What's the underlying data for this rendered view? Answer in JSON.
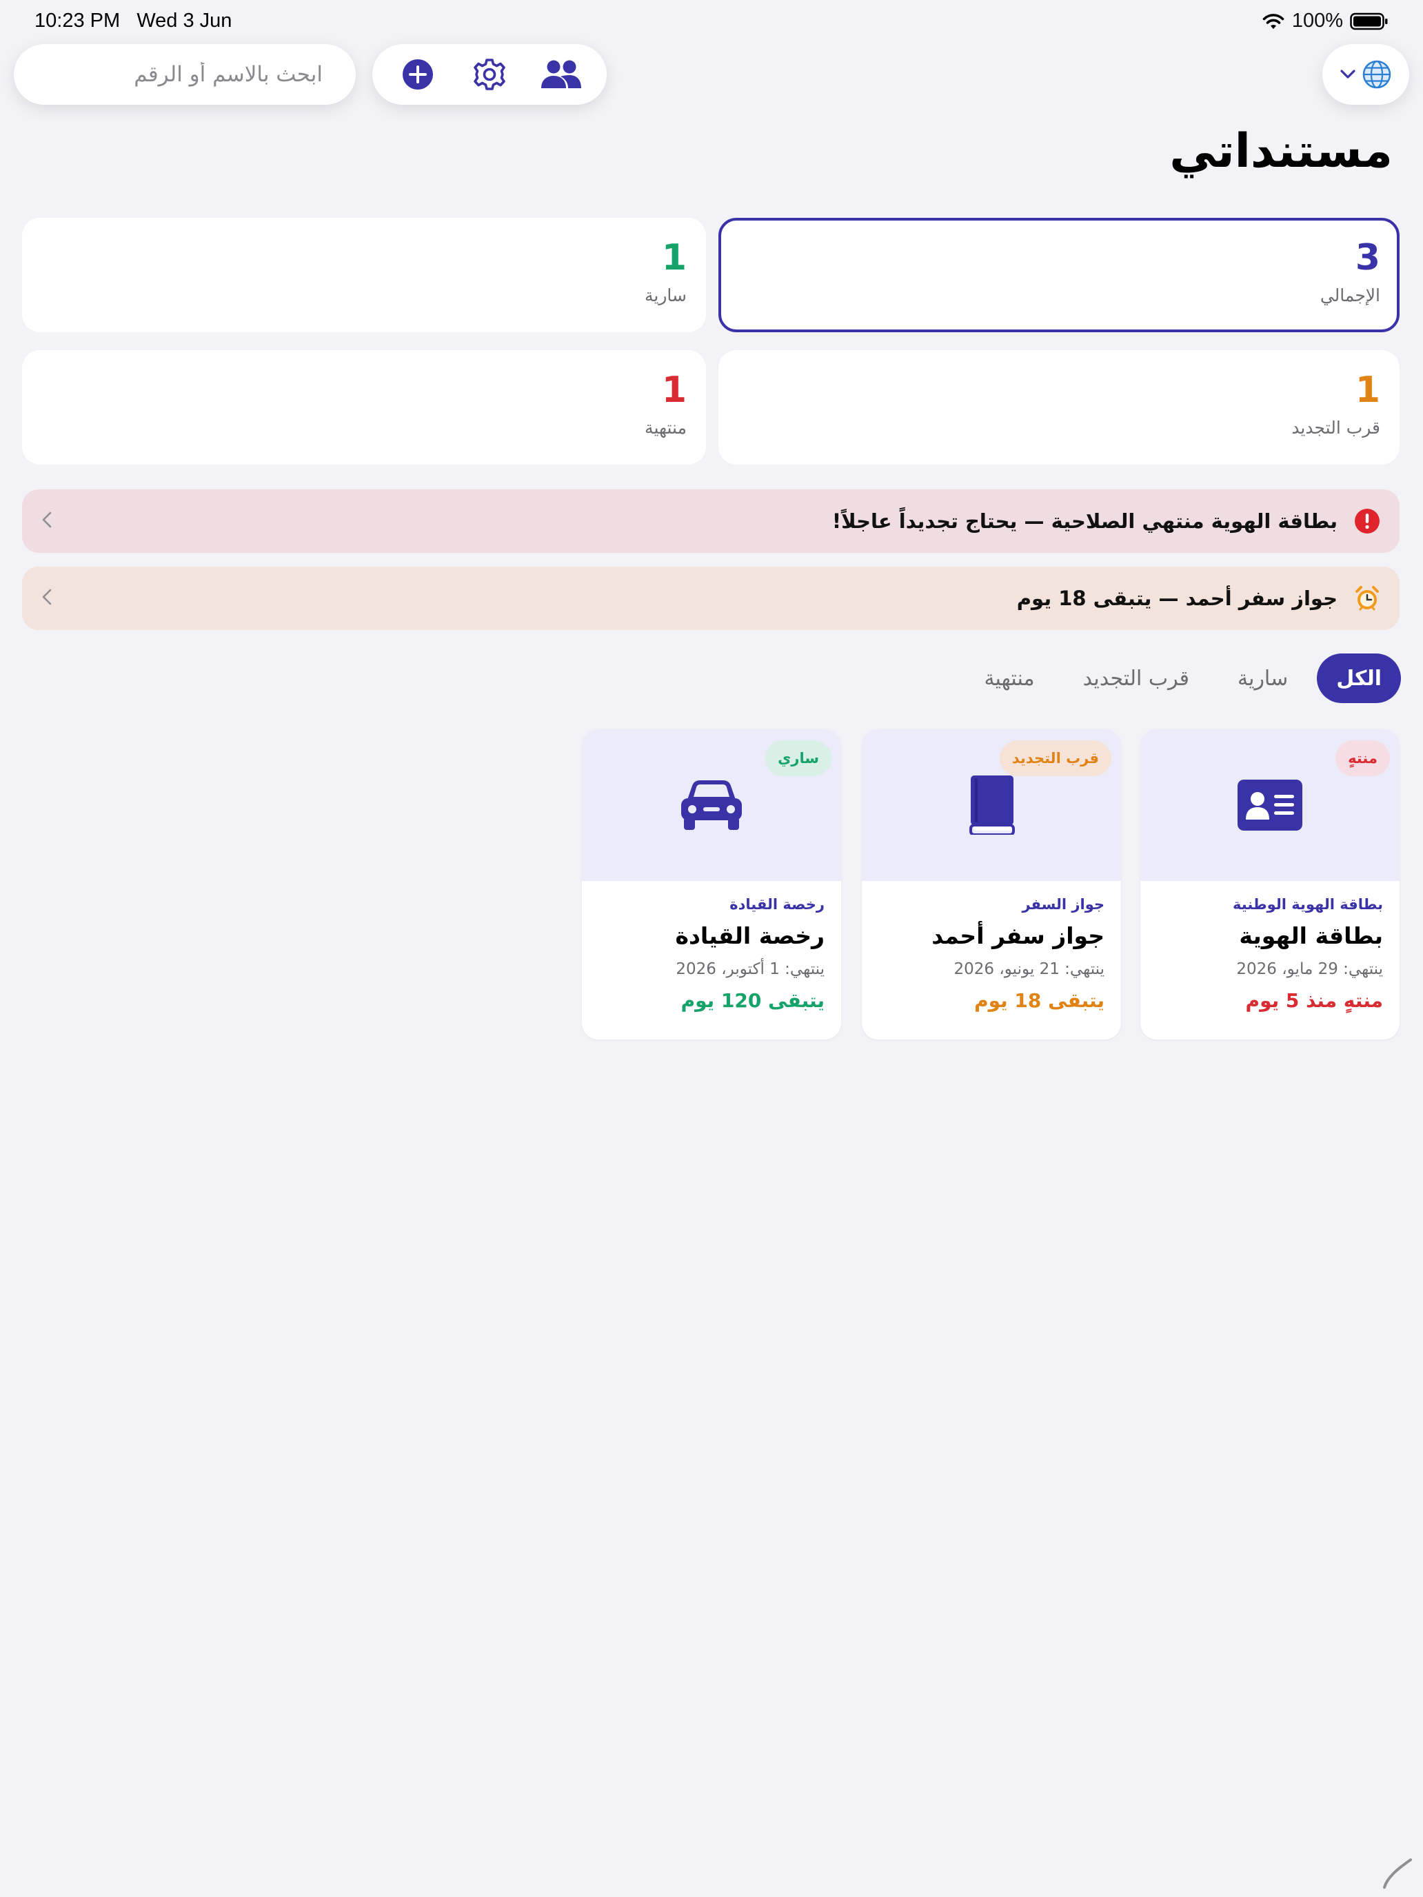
{
  "status_bar": {
    "time": "10:23 PM",
    "date": "Wed 3 Jun",
    "battery": "100%"
  },
  "toolbar": {
    "search_placeholder": "ابحث بالاسم أو الرقم",
    "language_icon": "globe-icon"
  },
  "page": {
    "title": "مستنداتي"
  },
  "stats": {
    "total": {
      "value": "3",
      "label": "الإجمالي",
      "color": "#3a33a8"
    },
    "active": {
      "value": "1",
      "label": "سارية",
      "color": "#16a36a"
    },
    "expiring": {
      "value": "1",
      "label": "قرب التجديد",
      "color": "#e08314"
    },
    "expired": {
      "value": "1",
      "label": "منتهية",
      "color": "#d92b32"
    }
  },
  "alerts": [
    {
      "text": "بطاقة الهوية منتهي الصلاحية — يحتاج تجديداً عاجلاً!",
      "icon": "exclamation-icon",
      "bg": "#f0dde1"
    },
    {
      "text": "جواز سفر أحمد — يتبقى 18 يوم",
      "icon": "alarm-clock-icon",
      "bg": "#f2e3dc"
    }
  ],
  "tabs": [
    "الكل",
    "سارية",
    "قرب التجديد",
    "منتهية"
  ],
  "documents": [
    {
      "badge": "منتهٍ",
      "category": "بطاقة الهوية الوطنية",
      "name": "بطاقة الهوية",
      "expiry": "ينتهي: 29 مايو، 2026",
      "remaining": "منتهٍ منذ 5 يوم",
      "icon": "id-card-icon",
      "status_color": "#d92b32",
      "badge_bg": "#f6dde4"
    },
    {
      "badge": "قرب التجديد",
      "category": "جواز السفر",
      "name": "جواز سفر أحمد",
      "expiry": "ينتهي: 21 يونيو، 2026",
      "remaining": "يتبقى 18 يوم",
      "icon": "book-icon",
      "status_color": "#e08314",
      "badge_bg": "#f6e2d6"
    },
    {
      "badge": "ساري",
      "category": "رخصة القيادة",
      "name": "رخصة القيادة",
      "expiry": "ينتهي: 1 أكتوبر، 2026",
      "remaining": "يتبقى 120 يوم",
      "icon": "car-icon",
      "status_color": "#16a36a",
      "badge_bg": "#d8f0e6"
    }
  ]
}
